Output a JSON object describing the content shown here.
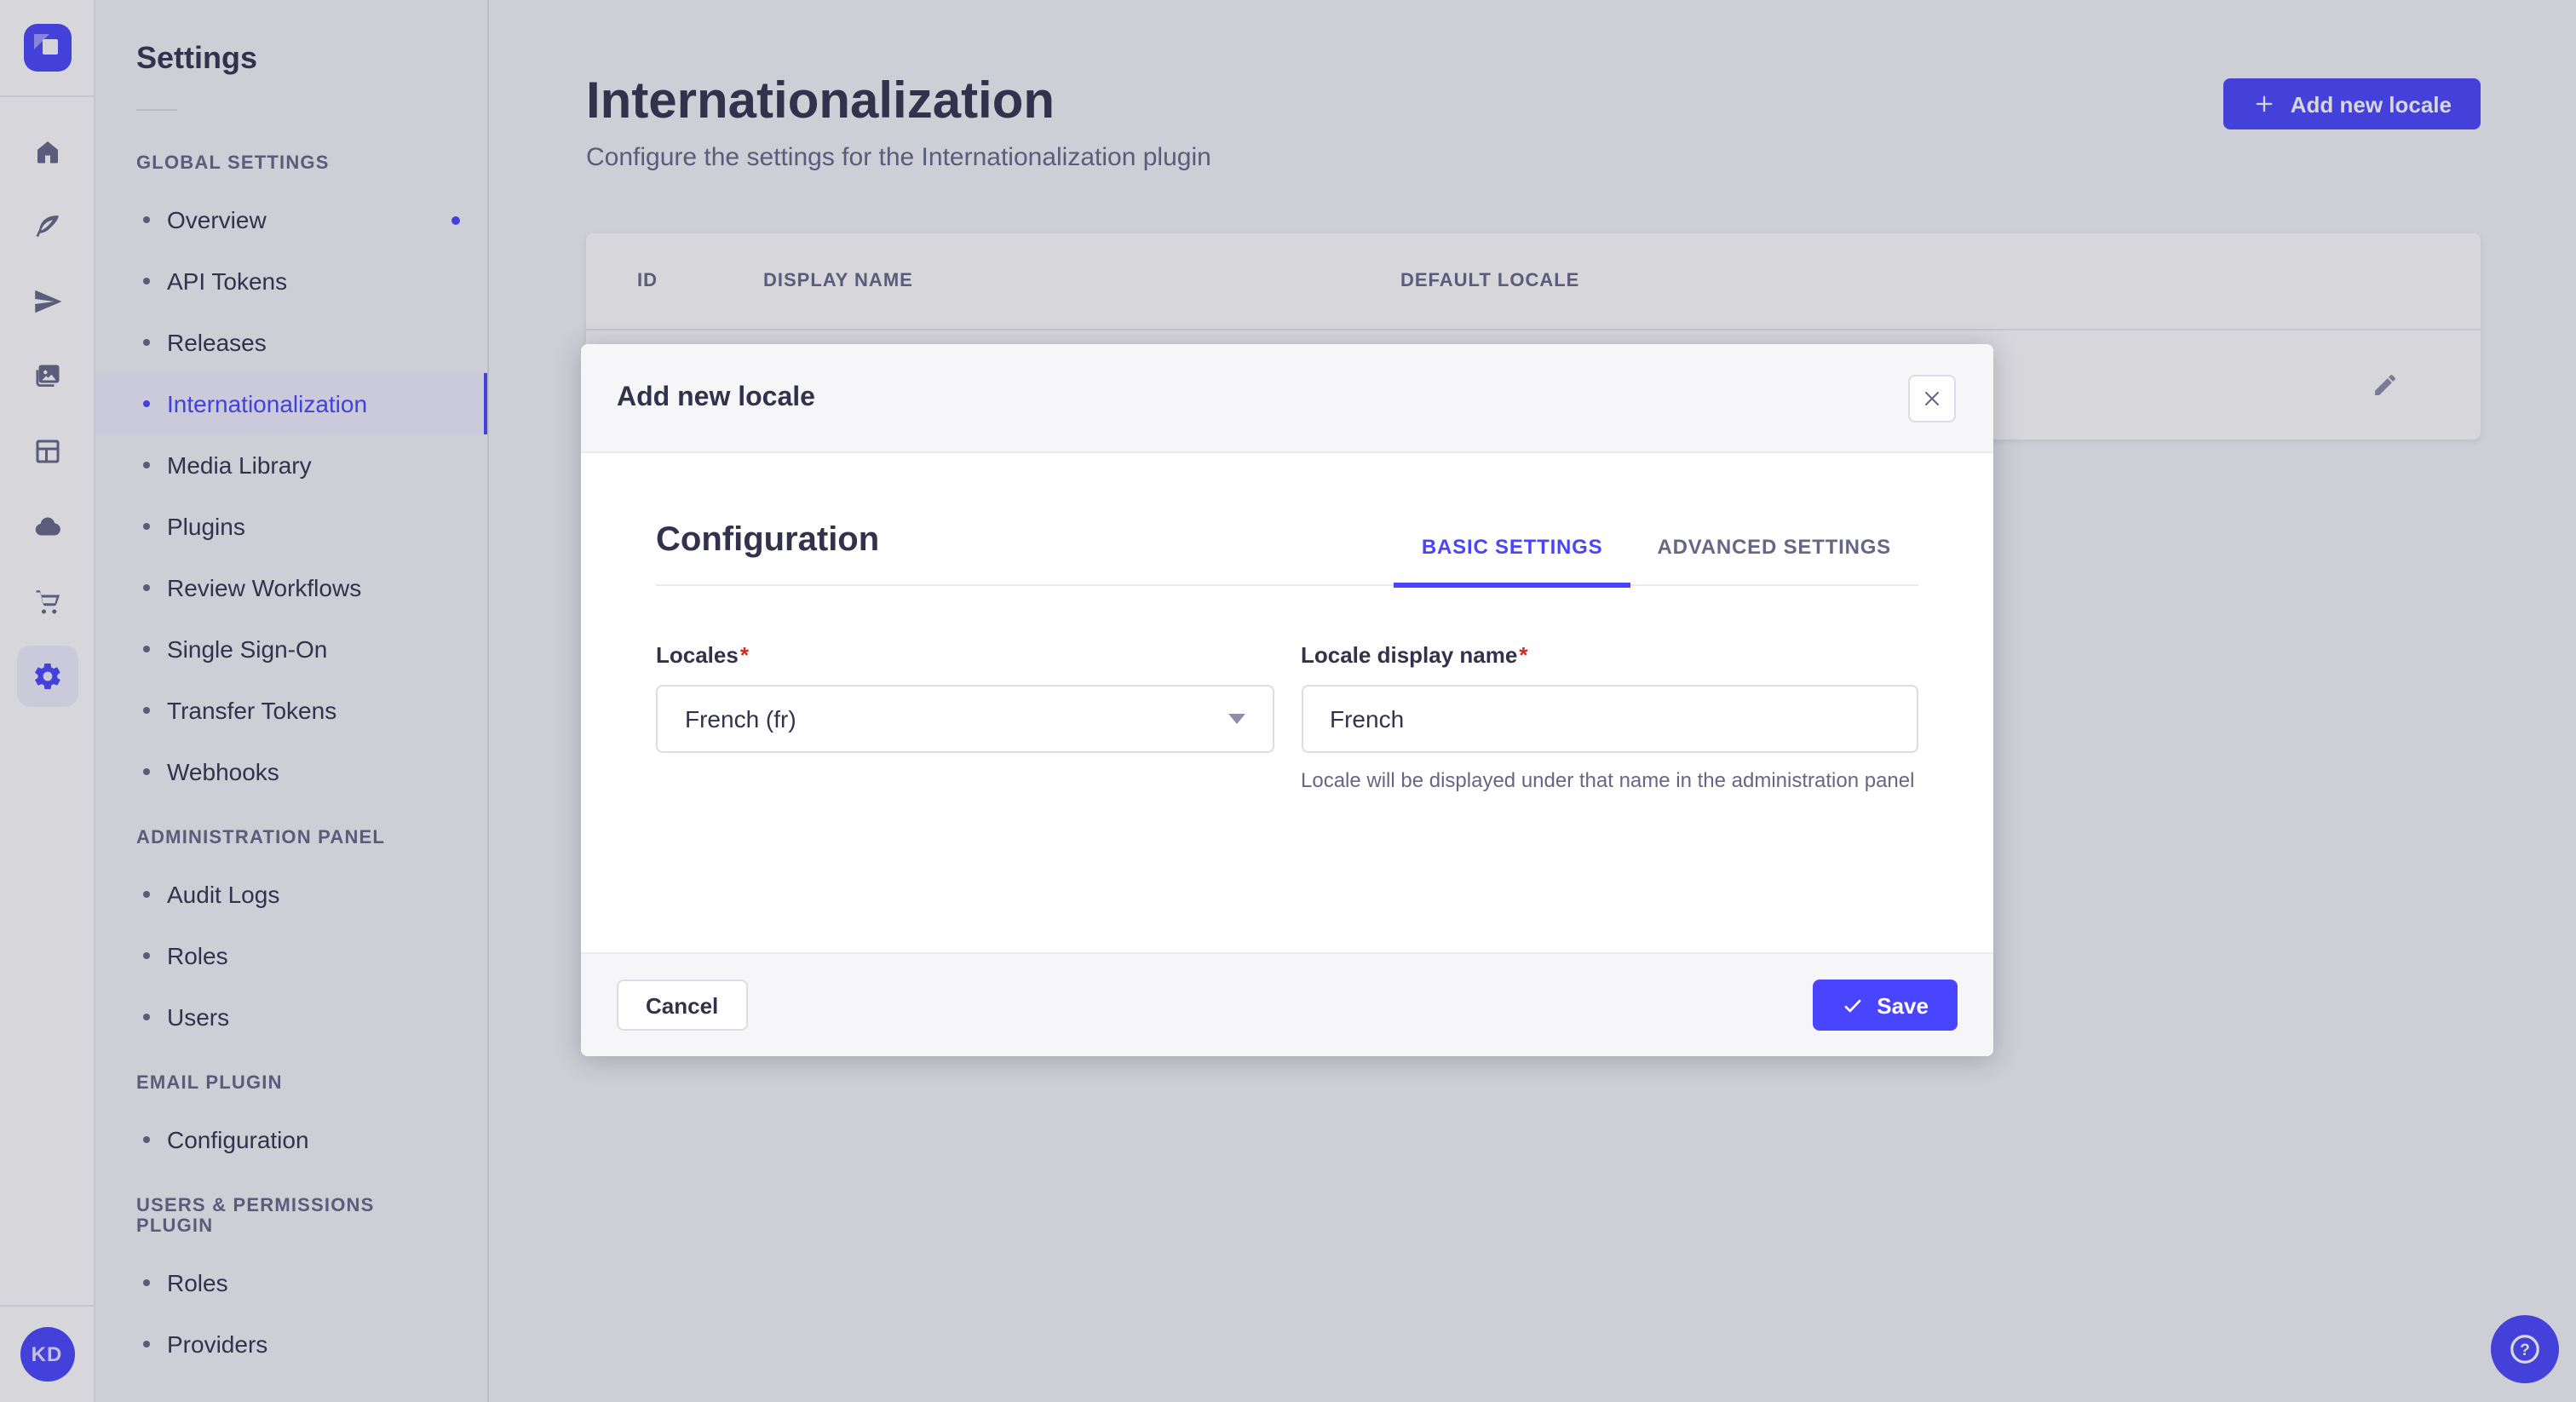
{
  "app": {
    "primary_color": "#4945ff",
    "brand_icon": "strapi-logo"
  },
  "rail": {
    "icons": [
      "home-icon",
      "feather-icon",
      "send-icon",
      "media-icon",
      "layout-icon",
      "cloud-icon",
      "cart-icon",
      "gear-icon"
    ],
    "active_icon": "gear-icon",
    "avatar_initials": "KD"
  },
  "sidebar": {
    "title": "Settings",
    "sections": [
      {
        "label": "GLOBAL SETTINGS",
        "items": [
          {
            "label": "Overview",
            "notification": true
          },
          {
            "label": "API Tokens"
          },
          {
            "label": "Releases"
          },
          {
            "label": "Internationalization",
            "active": true
          },
          {
            "label": "Media Library"
          },
          {
            "label": "Plugins"
          },
          {
            "label": "Review Workflows"
          },
          {
            "label": "Single Sign-On"
          },
          {
            "label": "Transfer Tokens"
          },
          {
            "label": "Webhooks"
          }
        ]
      },
      {
        "label": "ADMINISTRATION PANEL",
        "items": [
          {
            "label": "Audit Logs"
          },
          {
            "label": "Roles"
          },
          {
            "label": "Users"
          }
        ]
      },
      {
        "label": "EMAIL PLUGIN",
        "items": [
          {
            "label": "Configuration"
          }
        ]
      },
      {
        "label": "USERS & PERMISSIONS PLUGIN",
        "items": [
          {
            "label": "Roles"
          },
          {
            "label": "Providers"
          }
        ]
      }
    ]
  },
  "header": {
    "title": "Internationalization",
    "subtitle": "Configure the settings for the Internationalization plugin",
    "add_button": "Add new locale"
  },
  "table": {
    "columns": [
      "ID",
      "DISPLAY NAME",
      "DEFAULT LOCALE"
    ]
  },
  "modal": {
    "title": "Add new locale",
    "section_title": "Configuration",
    "tabs": [
      {
        "label": "BASIC SETTINGS",
        "active": true
      },
      {
        "label": "ADVANCED SETTINGS",
        "active": false
      }
    ],
    "fields": {
      "locales": {
        "label": "Locales",
        "required_mark": "*",
        "value": "French (fr)"
      },
      "display_name": {
        "label": "Locale display name",
        "required_mark": "*",
        "value": "French",
        "hint": "Locale will be displayed under that name in the administration panel"
      }
    },
    "cancel_label": "Cancel",
    "save_label": "Save"
  },
  "help": {
    "glyph": "?"
  }
}
